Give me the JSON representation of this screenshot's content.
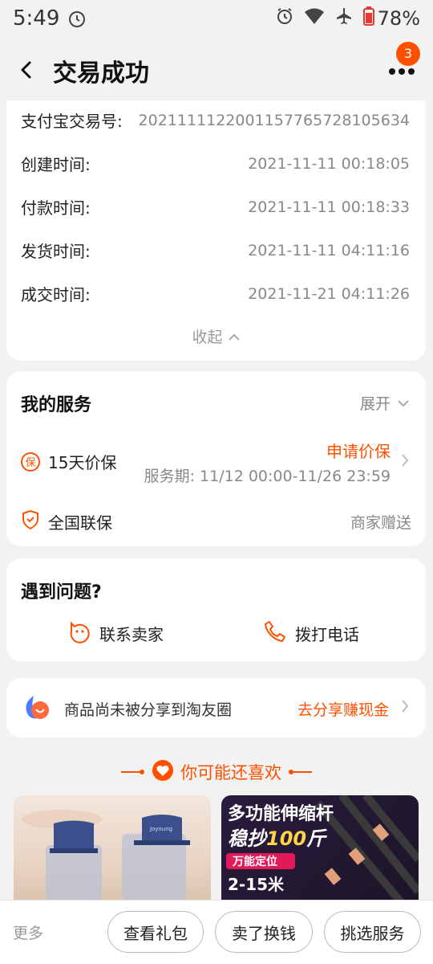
{
  "status_bar": {
    "time": "5:49",
    "battery": "78%"
  },
  "header": {
    "title": "交易成功",
    "badge_count": "3"
  },
  "info": {
    "rows": [
      {
        "label": "支付宝交易号:",
        "value": "2021111122001157765728105634"
      },
      {
        "label": "创建时间:",
        "value": "2021-11-11 00:18:05"
      },
      {
        "label": "付款时间:",
        "value": "2021-11-11 00:18:33"
      },
      {
        "label": "发货时间:",
        "value": "2021-11-11 04:11:16"
      },
      {
        "label": "成交时间:",
        "value": "2021-11-21 04:11:26"
      }
    ],
    "collapse_label": "收起"
  },
  "service": {
    "title": "我的服务",
    "expand_label": "展开",
    "price_protect": {
      "icon_text": "保",
      "label": "15天价保",
      "action": "申请价保",
      "period": "服务期: 11/12 00:00-11/26 23:59"
    },
    "national": {
      "label": "全国联保",
      "note": "商家赠送"
    }
  },
  "problem": {
    "title": "遇到问题?",
    "contact_seller": "联系卖家",
    "call_phone": "拨打电话"
  },
  "share": {
    "text": "商品尚未被分享到淘友圈",
    "action": "去分享赚现金"
  },
  "recommend": {
    "title": "你可能还喜欢"
  },
  "products": [
    {
      "brand": "Joyoung"
    },
    {
      "line1": "多功能伸缩杆",
      "line2_pre": "稳抄",
      "line2_num": "100",
      "line2_post": "斤",
      "tag": "万能定位",
      "range": "2-15米"
    }
  ],
  "bottom": {
    "more": "更多",
    "buttons": [
      "查看礼包",
      "卖了换钱",
      "挑选服务"
    ]
  },
  "colors": {
    "accent": "#ff5000"
  }
}
